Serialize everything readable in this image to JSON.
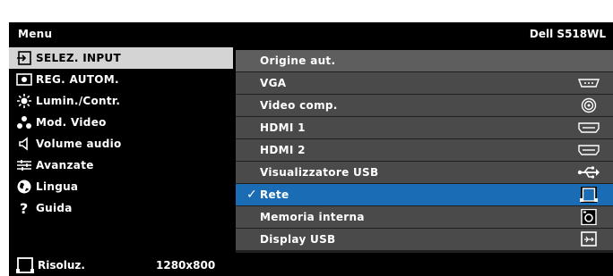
{
  "header": {
    "title": "Menu",
    "model": "Dell S518WL"
  },
  "left_menu": {
    "items": [
      {
        "label": "SELEZ. INPUT",
        "icon": "input-select-icon"
      },
      {
        "label": "REG. AUTOM.",
        "icon": "auto-adjust-icon"
      },
      {
        "label": "Lumin./Contr.",
        "icon": "brightness-icon"
      },
      {
        "label": "Mod. Video",
        "icon": "video-mode-icon"
      },
      {
        "label": "Volume audio",
        "icon": "speaker-icon"
      },
      {
        "label": "Avanzate",
        "icon": "advanced-settings-icon"
      },
      {
        "label": "Lingua",
        "icon": "globe-icon"
      },
      {
        "label": "Guida",
        "icon": "help-icon"
      }
    ],
    "selected": "SELEZ. INPUT"
  },
  "input_panel": {
    "items": [
      {
        "label": "Origine aut.",
        "icon": ""
      },
      {
        "label": "VGA",
        "icon": "vga-port-icon"
      },
      {
        "label": "Video comp.",
        "icon": "composite-video-icon"
      },
      {
        "label": "HDMI 1",
        "icon": "hdmi-port-icon"
      },
      {
        "label": "HDMI 2",
        "icon": "hdmi-port-icon"
      },
      {
        "label": "Visualizzatore USB",
        "icon": "usb-icon"
      },
      {
        "label": "Rete",
        "icon": "network-icon"
      },
      {
        "label": "Memoria interna",
        "icon": "internal-memory-icon"
      },
      {
        "label": "Display USB",
        "icon": "usb-display-icon"
      }
    ],
    "selected": "Rete",
    "check_mark": "✓"
  },
  "footer": {
    "label": "Risoluz.",
    "value": "1280x800",
    "icon": "network-icon"
  },
  "colors": {
    "background": "#000000",
    "selected_left": "#d4d4d4",
    "panel_row": "#4a4a4a",
    "active_row": "#1a6db4"
  }
}
